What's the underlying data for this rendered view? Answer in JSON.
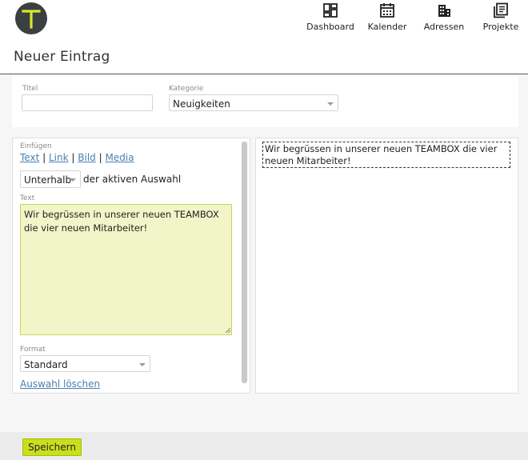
{
  "logo": {
    "letter": "T",
    "accent": "#d6e82a",
    "bg": "#3c3f42"
  },
  "nav": [
    {
      "label": "Dashboard",
      "icon": "dashboard-icon"
    },
    {
      "label": "Kalender",
      "icon": "calendar-icon"
    },
    {
      "label": "Adressen",
      "icon": "building-icon"
    },
    {
      "label": "Projekte",
      "icon": "projects-icon"
    }
  ],
  "page_title": "Neuer Eintrag",
  "form": {
    "titel_label": "Titel",
    "titel_value": "",
    "kategorie_label": "Kategorie",
    "kategorie_value": "Neuigkeiten"
  },
  "editor": {
    "insert_label": "Einfügen",
    "insert_links": [
      "Text",
      "Link",
      "Bild",
      "Media"
    ],
    "position_value": "Unterhalb",
    "position_suffix": "der aktiven Auswahl",
    "text_label": "Text",
    "text_value": "Wir begrüssen in unserer neuen TEAMBOX die vier neuen Mitarbeiter!",
    "format_label": "Format",
    "format_value": "Standard",
    "clear_label": "Auswahl löschen"
  },
  "preview": {
    "text": "Wir begrüssen in unserer neuen TEAMBOX die vier neuen Mitarbeiter!"
  },
  "footer": {
    "save_label": "Speichern"
  },
  "colors": {
    "accent": "#c9df1e",
    "textarea_bg": "#f2f5c8",
    "link": "#4a7fb0"
  }
}
